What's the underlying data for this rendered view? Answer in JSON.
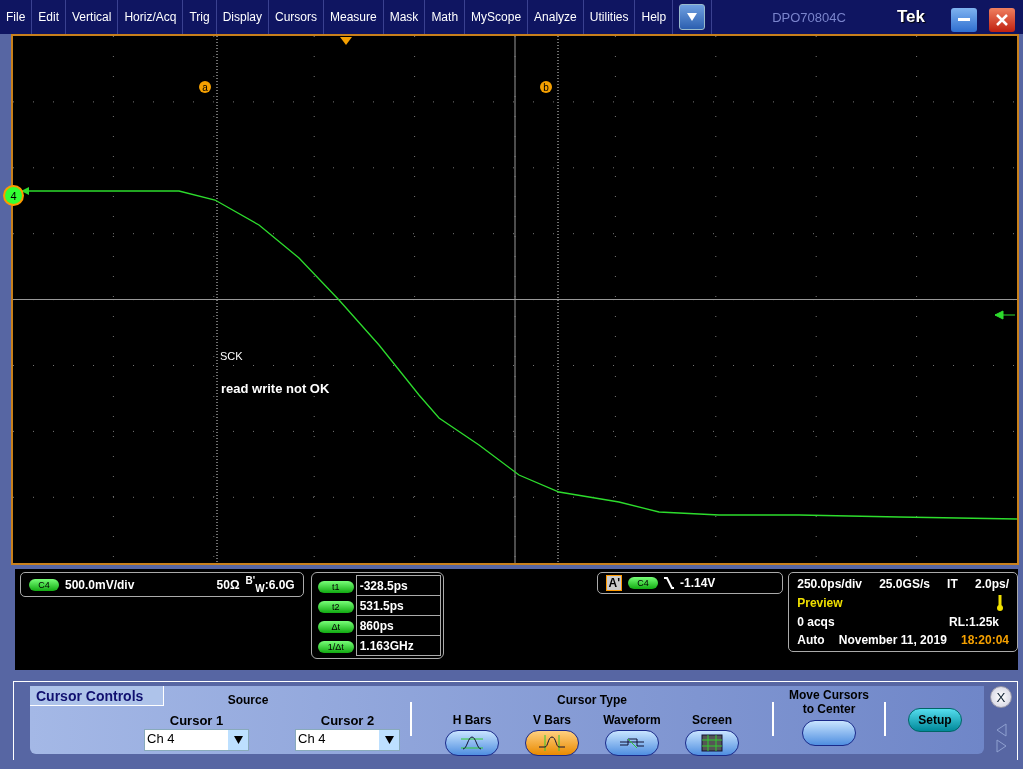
{
  "menu": {
    "items": [
      {
        "label": "File"
      },
      {
        "label": "Edit"
      },
      {
        "label": "Vertical"
      },
      {
        "label": "Horiz/Acq"
      },
      {
        "label": "Trig"
      },
      {
        "label": "Display"
      },
      {
        "label": "Cursors"
      },
      {
        "label": "Measure"
      },
      {
        "label": "Mask"
      },
      {
        "label": "Math"
      },
      {
        "label": "MyScope"
      },
      {
        "label": "Analyze"
      },
      {
        "label": "Utilities"
      },
      {
        "label": "Help"
      }
    ],
    "model": "DPO70804C",
    "brand": "Tek"
  },
  "scope": {
    "channel_marker": "4",
    "cursor_labels": [
      "a",
      "b"
    ],
    "annotations": [
      "SCK",
      "read write not OK"
    ]
  },
  "channel_readout": {
    "channel": "C4",
    "scale": "500.0mV/div",
    "impedance": "50Ω",
    "bandwidth": "$^{B'}$$_{W}$:6.0G"
  },
  "cursor_readouts": [
    {
      "label": "t1",
      "value": "-328.5ps"
    },
    {
      "label": "t2",
      "value": "531.5ps"
    },
    {
      "label": "Δt",
      "value": "860ps"
    },
    {
      "label": "1/Δt",
      "value": "1.163GHz"
    }
  ],
  "trigger": {
    "label": "A'",
    "channel": "C4",
    "level": "-1.14V"
  },
  "horizontal": {
    "scale": "250.0ps/div",
    "sample_rate": "25.0GS/s",
    "mode": "IT",
    "resolution": "2.0ps/",
    "status": "Preview",
    "acqs": "0 acqs",
    "record_length": "RL:1.25k",
    "trigger_mode": "Auto",
    "date": "November 11, 2019",
    "time": "18:20:04"
  },
  "cursor_controls": {
    "title": "Cursor Controls",
    "source_heading": "Source",
    "sources": [
      {
        "label": "Cursor 1",
        "value": "Ch 4"
      },
      {
        "label": "Cursor 2",
        "value": "Ch 4"
      }
    ],
    "type_heading": "Cursor Type",
    "types": [
      {
        "label": "H Bars",
        "kind": "hbars",
        "selected": false
      },
      {
        "label": "V Bars",
        "kind": "vbars",
        "selected": true
      },
      {
        "label": "Waveform",
        "kind": "waveform",
        "selected": false
      },
      {
        "label": "Screen",
        "kind": "screen",
        "selected": false
      }
    ],
    "move_label": "Move Cursors to Center",
    "setup": "Setup",
    "close": "X"
  }
}
